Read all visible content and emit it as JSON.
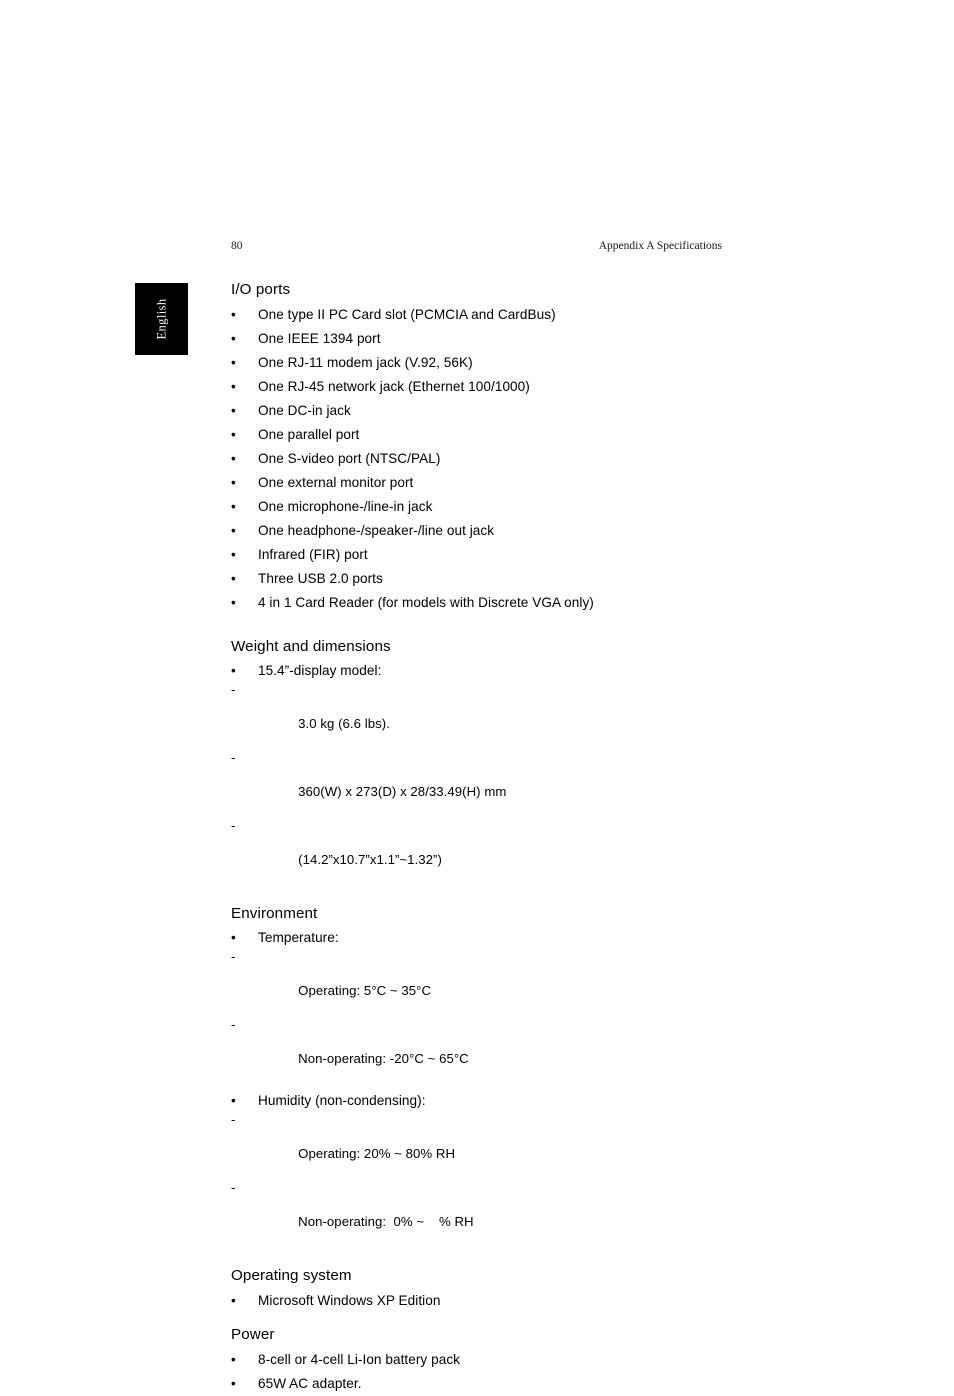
{
  "page": {
    "folio": "80",
    "running_head": "Appendix A Specifications",
    "language_tab": "English",
    "background_color": "#ffffff",
    "tab_color": "#000000",
    "text_color": "#000000"
  },
  "sections": [
    {
      "title": "I/O ports",
      "bullets": [
        "One type II PC Card slot (PCMCIA and CardBus)",
        "One IEEE 1394 port",
        "One RJ-11 modem jack (V.92, 56K)",
        "One RJ-45 network jack (Ethernet 100/1000)",
        "One DC-in jack",
        "One parallel port",
        "One S-video port (NTSC/PAL)",
        "One external monitor port",
        "One microphone-/line-in jack",
        "One headphone-/speaker-/line out jack",
        "Infrared (FIR) port",
        "Three USB 2.0 ports",
        "4 in 1 Card Reader (for models with Discrete VGA only)"
      ]
    },
    {
      "title": "Weight and dimensions",
      "groups": [
        {
          "bullet": "15.4”-display model:",
          "subitems": [
            "3.0 kg (6.6 lbs).",
            "360(W) x 273(D) x 28/33.49(H) mm",
            "(14.2”x10.7”x1.1”~1.32”)"
          ]
        }
      ]
    },
    {
      "title": "Environment",
      "groups": [
        {
          "bullet": "Temperature:",
          "subitems": [
            "Operating: 5°C ~ 35°C",
            "Non-operating: -20°C ~ 65°C"
          ]
        },
        {
          "bullet": "Humidity (non-condensing):",
          "subitems": [
            "Operating: 20% ~ 80% RH",
            "Non-operating:  0% ~    % RH"
          ]
        }
      ]
    },
    {
      "title": "Operating system",
      "bullets": [
        "Microsoft Windows XP Edition"
      ]
    },
    {
      "title": "Power",
      "bullets": [
        "8-cell or 4-cell Li-Ion battery pack",
        "65W AC adapter."
      ]
    }
  ],
  "glyphs": {
    "bullet": "•",
    "dash": "-"
  }
}
